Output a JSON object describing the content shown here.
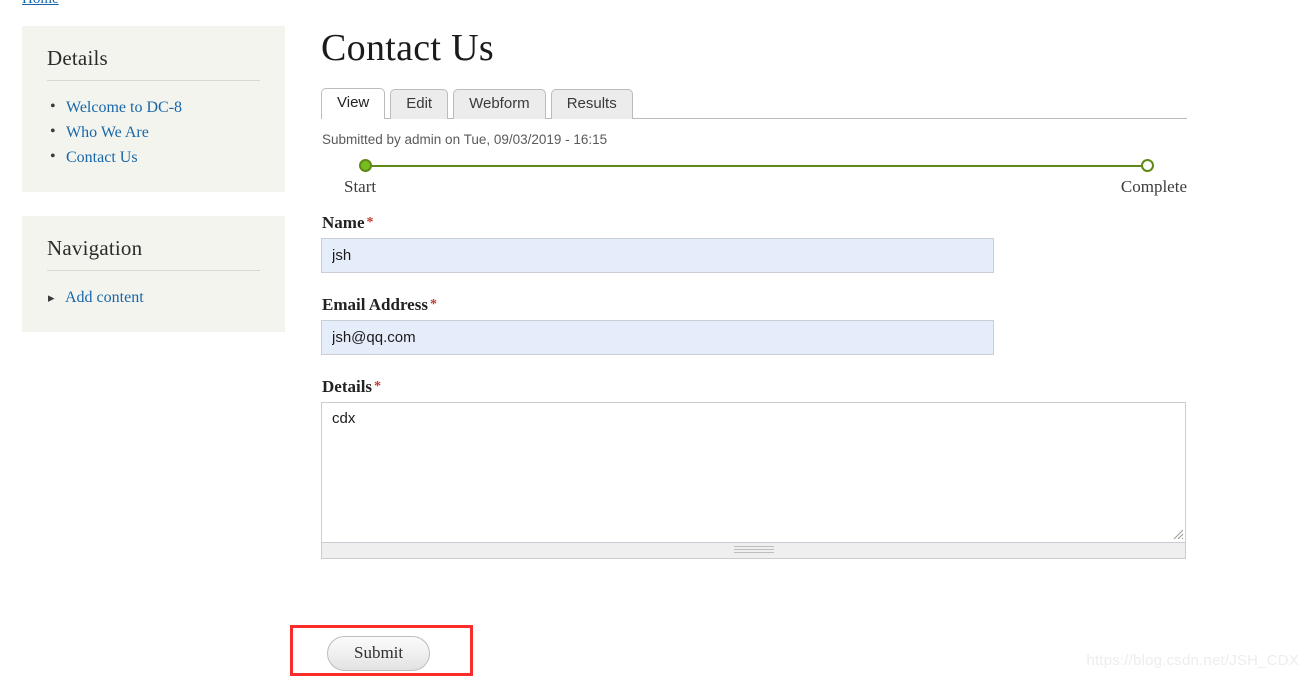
{
  "breadcrumb": {
    "home_label": "Home"
  },
  "sidebar": {
    "blocks": [
      {
        "title": "Details",
        "links": [
          {
            "label": "Welcome to DC-8"
          },
          {
            "label": "Who We Are"
          },
          {
            "label": "Contact Us"
          }
        ]
      },
      {
        "title": "Navigation",
        "links": [
          {
            "label": "Add content"
          }
        ]
      }
    ]
  },
  "main": {
    "page_title": "Contact Us",
    "tabs": [
      {
        "label": "View",
        "active": true
      },
      {
        "label": "Edit",
        "active": false
      },
      {
        "label": "Webform",
        "active": false
      },
      {
        "label": "Results",
        "active": false
      }
    ],
    "submitted_text": "Submitted by admin on Tue, 09/03/2019 - 16:15",
    "progress": {
      "start_label": "Start",
      "complete_label": "Complete",
      "start_state": "filled",
      "complete_state": "empty",
      "line_color": "#5f8a18",
      "node_fill_color": "#77bc1f"
    },
    "form": {
      "fields": [
        {
          "label": "Name",
          "required_marker": "*",
          "value": "jsh",
          "placeholder": "",
          "type": "text"
        },
        {
          "label": "Email Address",
          "required_marker": "*",
          "value": "jsh@qq.com",
          "placeholder": "",
          "type": "text"
        },
        {
          "label": "Details",
          "required_marker": "*",
          "value": "cdx",
          "placeholder": "",
          "type": "textarea"
        }
      ],
      "submit_label": "Submit"
    }
  },
  "annotation": {
    "highlight_color": "#fb2c2c"
  },
  "watermark": {
    "text": "https://blog.csdn.net/JSH_CDX"
  }
}
